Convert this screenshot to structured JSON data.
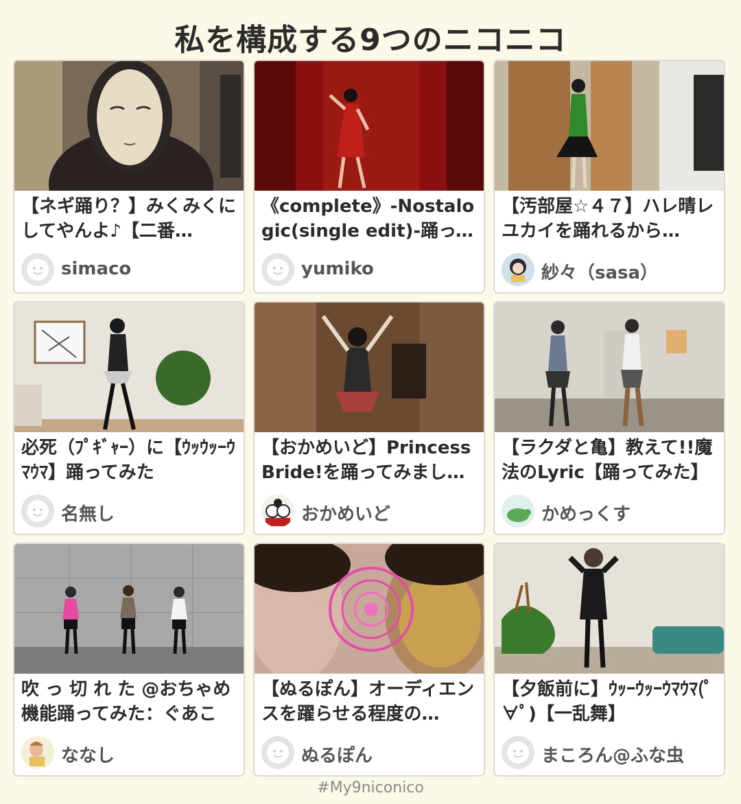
{
  "page": {
    "title": "私を構成する9つのニコニコ",
    "hashtag": "#My9niconico"
  },
  "colors": {
    "background": "#fdf9e8",
    "card_border": "#d9d9d6",
    "title_text": "#2b2b2b",
    "author_text": "#555555"
  },
  "cards": [
    {
      "title": "【ネギ踊り？】みくみくにしてやんよ♪【二番…",
      "author": "simaco",
      "avatar_icon": "default-face-icon"
    },
    {
      "title": "《complete》-Nostalogic(single edit)-踊ってみた",
      "author": "yumiko",
      "avatar_icon": "default-face-icon"
    },
    {
      "title": "【汚部屋☆４７】ハレ晴レユカイを踊れるから…",
      "author": "紗々（sasa）",
      "avatar_icon": "user-photo-icon"
    },
    {
      "title": "必死（ﾌﾟｷﾞｬｰ）に【ｳｯｳｯｰｳﾏｳﾏ】踊ってみた",
      "author": "名無し",
      "avatar_icon": "default-face-icon"
    },
    {
      "title": "【おかめいど】Princess Bride!を踊ってみまし…",
      "author": "おかめいど",
      "avatar_icon": "okame-mask-icon"
    },
    {
      "title": "【ラクダと亀】教えて!!魔法のLyric【踊ってみた】",
      "author": "かめっくす",
      "avatar_icon": "turtle-icon"
    },
    {
      "title": "吹 っ 切 れ た @おちゃめ機能踊ってみた：ぐあこ",
      "author": "ななし",
      "avatar_icon": "drawing-icon"
    },
    {
      "title": "【ぬるぽん】オーディエンスを躍らせる程度の…",
      "author": "ぬるぽん",
      "avatar_icon": "default-face-icon"
    },
    {
      "title": "【夕飯前に】ｳｯｰｳｯｰｳﾏｳﾏ(ﾟ∀ﾟ)【一乱舞】",
      "author": "まころん@ふな虫",
      "avatar_icon": "default-face-icon"
    }
  ]
}
